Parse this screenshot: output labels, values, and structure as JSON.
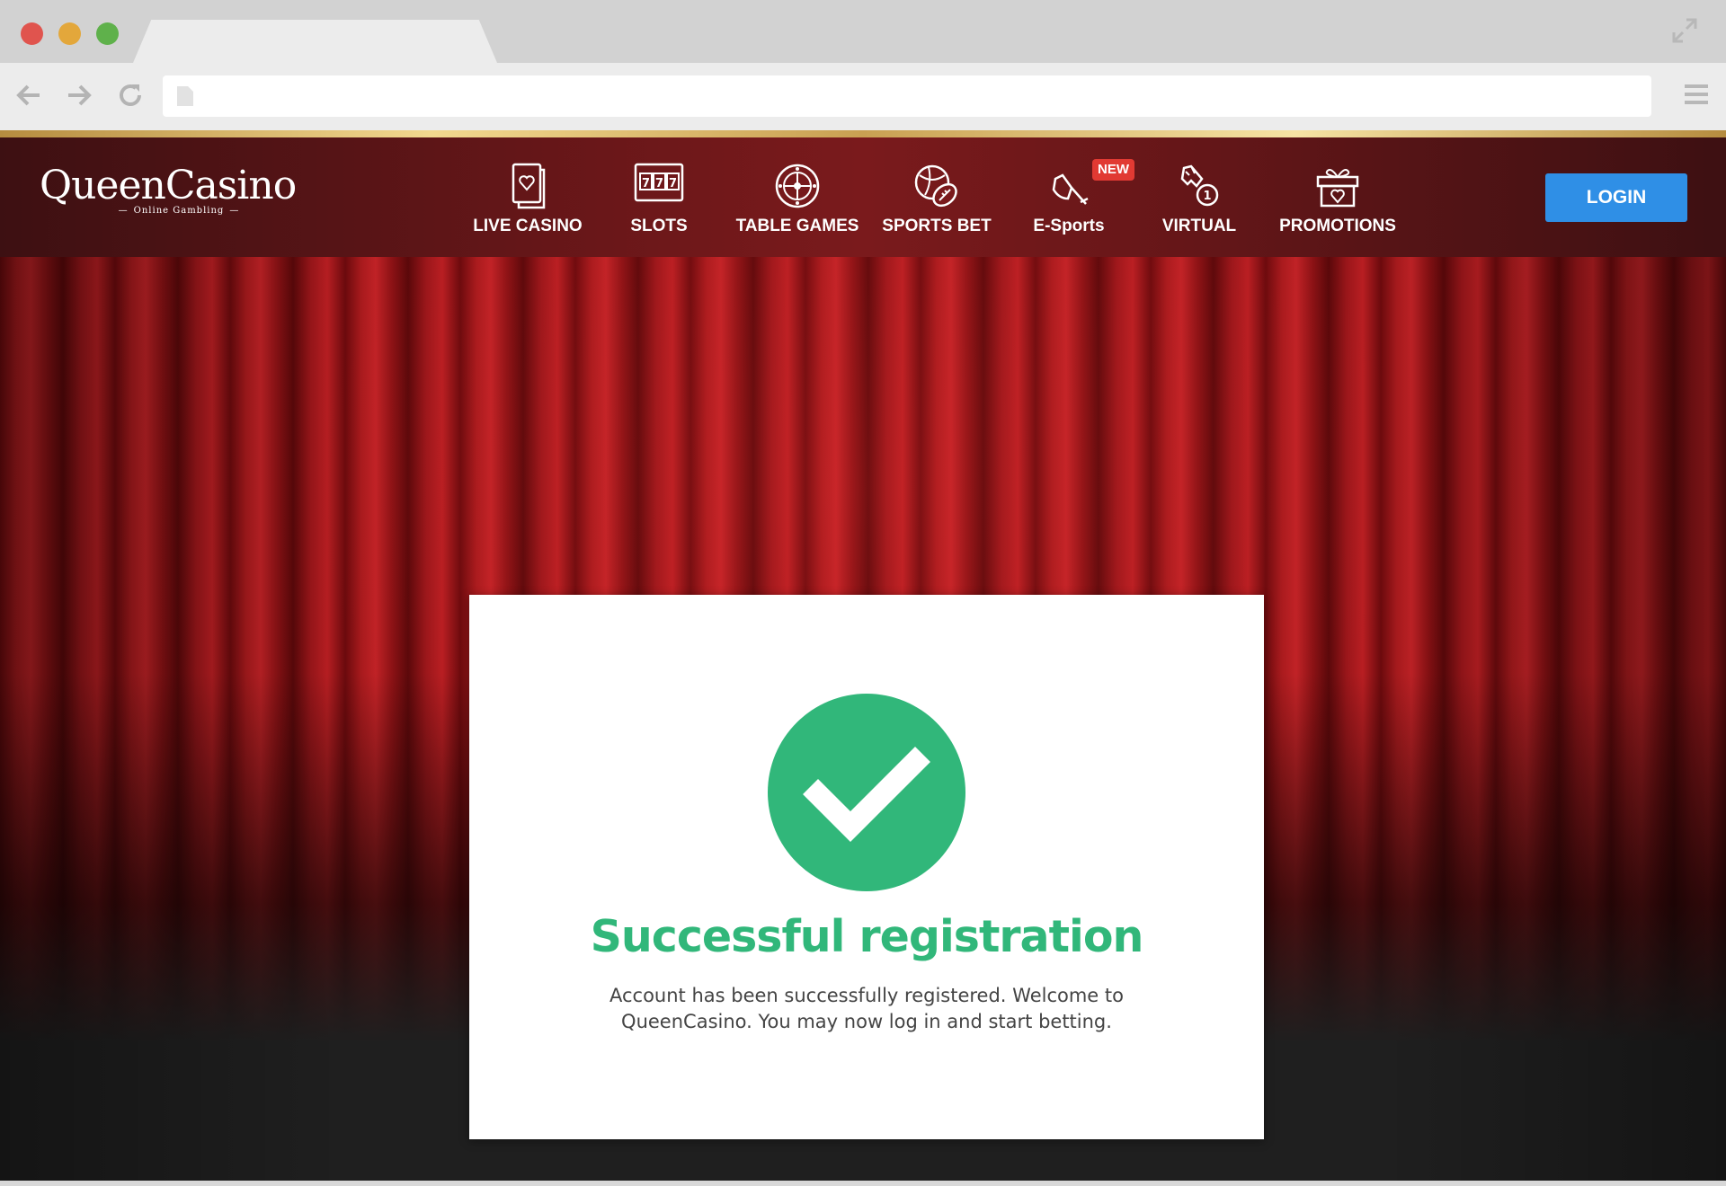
{
  "browser": {
    "tab_title": "",
    "url": ""
  },
  "site": {
    "logo": {
      "main": "QueenCasino",
      "sub": "Online Gambling"
    },
    "nav": [
      {
        "label": "LIVE CASINO",
        "icon": "cards-icon"
      },
      {
        "label": "SLOTS",
        "icon": "slot-machine-icon"
      },
      {
        "label": "TABLE GAMES",
        "icon": "roulette-icon"
      },
      {
        "label": "SPORTS BET",
        "icon": "sports-balls-icon"
      },
      {
        "label": "E-Sports",
        "icon": "esports-icon",
        "badge": "NEW"
      },
      {
        "label": "VIRTUAL",
        "icon": "horse-icon"
      },
      {
        "label": "PROMOTIONS",
        "icon": "gift-icon"
      }
    ],
    "login_label": "LOGIN"
  },
  "modal": {
    "title": "Successful registration",
    "message": "Account has been successfully registered. Welcome to QueenCasino. You may now log in and start betting."
  },
  "colors": {
    "success_green": "#31b77a",
    "login_blue": "#2f8fe6",
    "header_red": "#7a1a1c",
    "badge_red": "#e13a33"
  }
}
